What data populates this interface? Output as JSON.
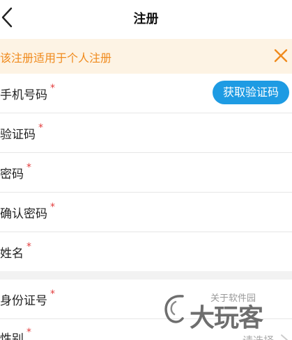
{
  "header": {
    "title": "注册",
    "back_icon": "chevron-left-icon"
  },
  "notice": {
    "text": "该注册适用于个人注册",
    "close_icon": "close-icon",
    "color": "#f08a1c",
    "background": "#fdf3e4"
  },
  "form": {
    "required_mark": "*",
    "phone_label": "手机号码",
    "get_code_label": "获取验证码",
    "code_label": "验证码",
    "password_label": "密码",
    "confirm_password_label": "确认密码",
    "name_label": "姓名",
    "id_number_label": "身份证号",
    "gender_label": "性别",
    "gender_placeholder": "请选择"
  },
  "watermark": {
    "logo_text": "大玩客",
    "small_text": "关于软件园"
  },
  "colors": {
    "accent": "#1e9be3",
    "required": "#e23c3c"
  }
}
